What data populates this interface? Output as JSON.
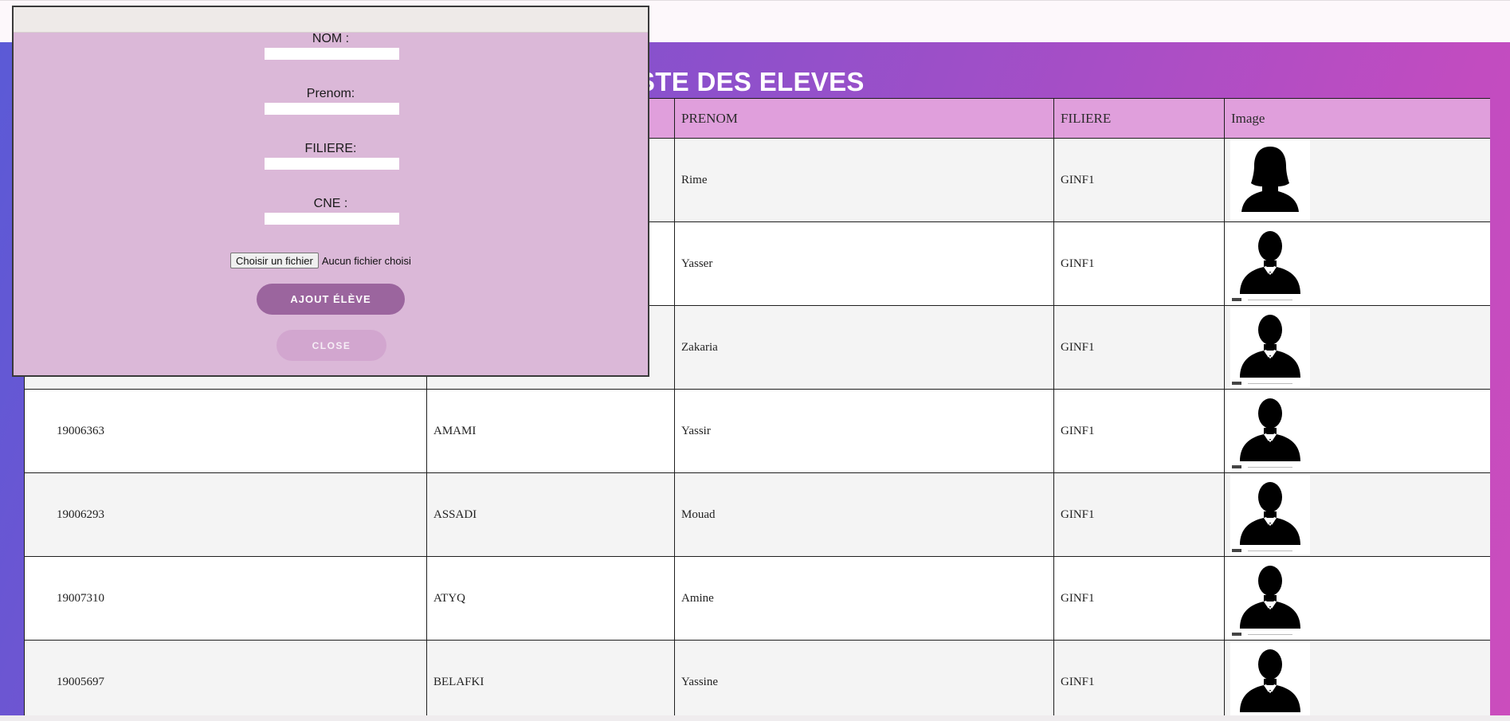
{
  "page": {
    "title": "LISTE DES ELEVES",
    "colors": {
      "header_row": "#e09fdc",
      "modal_bg": "#dbb8d8",
      "accent_button": "#9b659e"
    }
  },
  "table": {
    "headers": {
      "prenom": "PRENOM",
      "filiere": "FILIERE",
      "image": "Image"
    },
    "rows": [
      {
        "cne": "",
        "nom": "",
        "prenom": "Rime",
        "filiere": "GINF1",
        "image_icon": "female-avatar-icon"
      },
      {
        "cne": "",
        "nom": "",
        "prenom": "Yasser",
        "filiere": "GINF1",
        "image_icon": "male-avatar-icon"
      },
      {
        "cne": "",
        "nom": "",
        "prenom": "Zakaria",
        "filiere": "GINF1",
        "image_icon": "male-avatar-icon"
      },
      {
        "cne": "19006363",
        "nom": "AMAMI",
        "prenom": "Yassir",
        "filiere": "GINF1",
        "image_icon": "male-avatar-icon"
      },
      {
        "cne": "19006293",
        "nom": "ASSADI",
        "prenom": "Mouad",
        "filiere": "GINF1",
        "image_icon": "male-avatar-icon"
      },
      {
        "cne": "19007310",
        "nom": "ATYQ",
        "prenom": "Amine",
        "filiere": "GINF1",
        "image_icon": "male-avatar-icon"
      },
      {
        "cne": "19005697",
        "nom": "BELAFKI",
        "prenom": "Yassine",
        "filiere": "GINF1",
        "image_icon": "male-avatar-icon"
      }
    ]
  },
  "modal": {
    "nom_label": "NOM :",
    "prenom_label": "Prenom:",
    "filiere_label": "FILIERE:",
    "cne_label": "CNE :",
    "nom_value": "",
    "prenom_value": "",
    "filiere_value": "",
    "cne_value": "",
    "file_button": "Choisir un fichier",
    "file_status": "Aucun fichier choisi",
    "add_button": "AJOUT ÉLÈVE",
    "close_button": "CLOSE"
  }
}
